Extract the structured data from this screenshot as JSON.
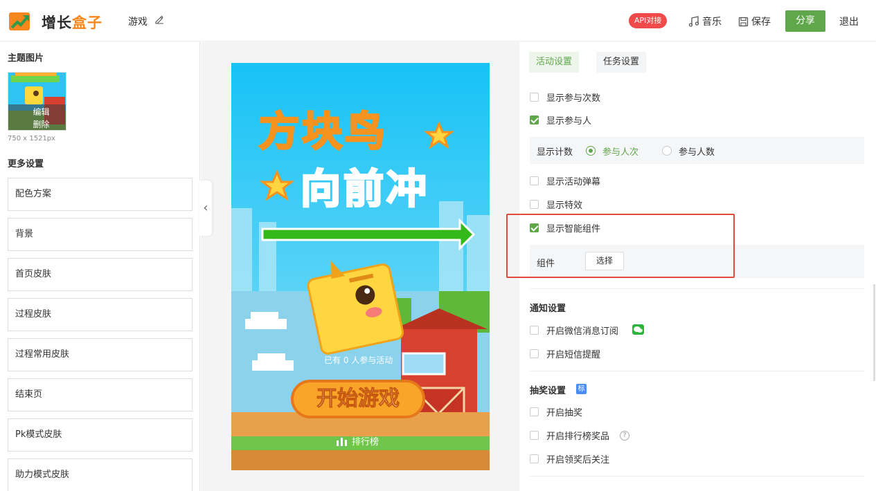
{
  "header": {
    "logo_part1": "增长",
    "logo_part2": "盒子",
    "project_name": "游戏",
    "api_badge": "API对接",
    "music_label": "音乐",
    "save_label": "保存",
    "share_label": "分享",
    "exit_label": "退出"
  },
  "left": {
    "theme_title": "主题图片",
    "thumb_edit": "编辑",
    "thumb_delete": "删除",
    "image_size": "750 x 1521px",
    "more_title": "更多设置",
    "items": [
      "配色方案",
      "背景",
      "首页皮肤",
      "过程皮肤",
      "过程常用皮肤",
      "结束页",
      "Pk模式皮肤",
      "助力模式皮肤"
    ]
  },
  "preview": {
    "title_line1": "方块鸟",
    "title_line2": "向前冲",
    "participants_text": "已有 0 人参与活动",
    "start_button": "开始游戏",
    "rank_label": "排行榜"
  },
  "right": {
    "tabs": [
      "活动设置",
      "任务设置"
    ],
    "opt_show_times": "显示参与次数",
    "opt_show_people": "显示参与人",
    "count_label": "显示计数",
    "radio_times": "参与人次",
    "radio_people": "参与人数",
    "opt_barrage": "显示活动弹幕",
    "opt_effects": "显示特效",
    "opt_smart": "显示智能组件",
    "component_label": "组件",
    "select_label": "选择",
    "notify_title": "通知设置",
    "opt_wechat": "开启微信消息订阅",
    "opt_sms": "开启短信提醒",
    "lottery_title": "抽奖设置",
    "lottery_tag": "标",
    "opt_lottery": "开启抽奖",
    "opt_rank_prize": "开启排行榜奖品",
    "opt_follow": "开启领奖后关注"
  },
  "colors": {
    "accent": "#5fa74a",
    "brand_orange": "#f7861d",
    "api_red": "#f04a4a",
    "highlight_red": "#e24a3b",
    "sky": "#22c4f5"
  }
}
